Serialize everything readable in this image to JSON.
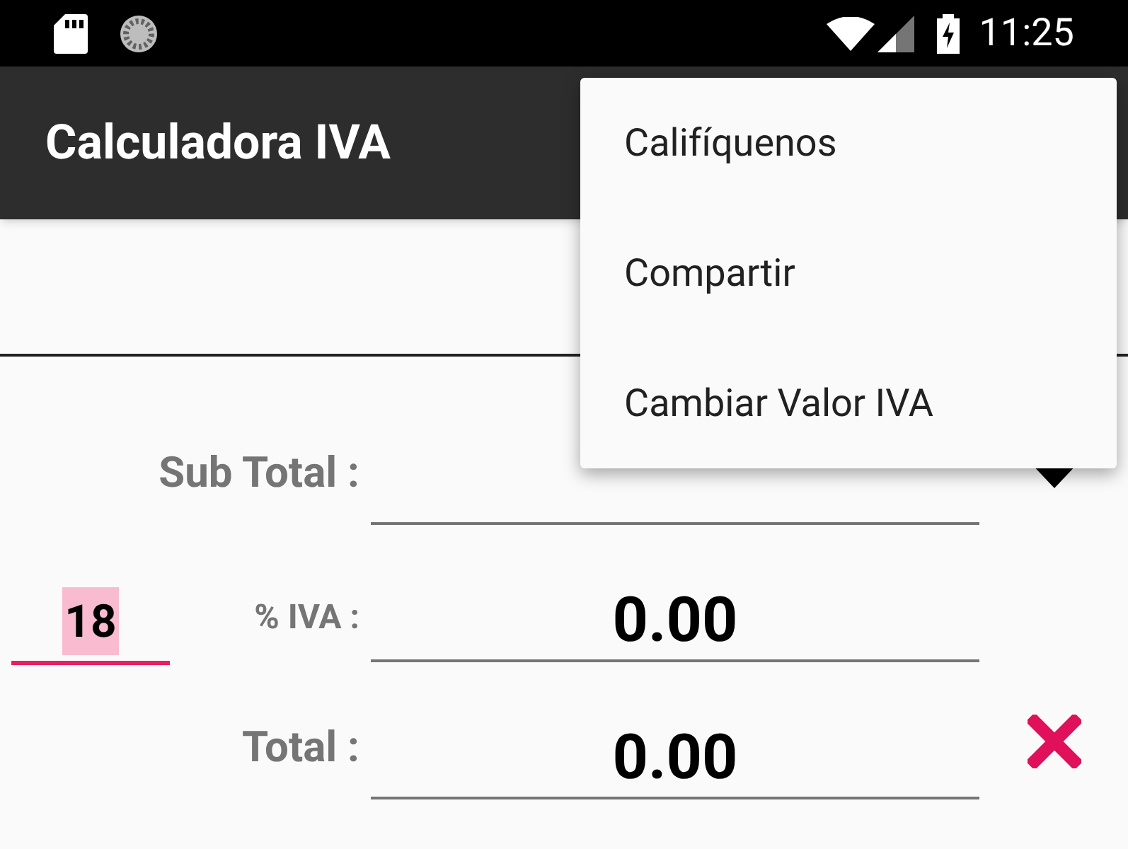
{
  "status_bar": {
    "time": "11:25"
  },
  "toolbar": {
    "title": "Calculadora IVA"
  },
  "menu": {
    "items": [
      "Califíquenos",
      "Compartir",
      "Cambiar Valor IVA"
    ]
  },
  "iva_rate": {
    "value": "18",
    "focused": true
  },
  "rows": [
    {
      "kind": "amount",
      "label": "Sub Total :",
      "action": {
        "kind": "dropdown"
      }
    },
    {
      "kind": "percent",
      "label": "% IVA :",
      "value": "0.00"
    },
    {
      "kind": "amount",
      "label": "Total :",
      "value": "0.00",
      "action": {
        "kind": "clear"
      }
    }
  ]
}
